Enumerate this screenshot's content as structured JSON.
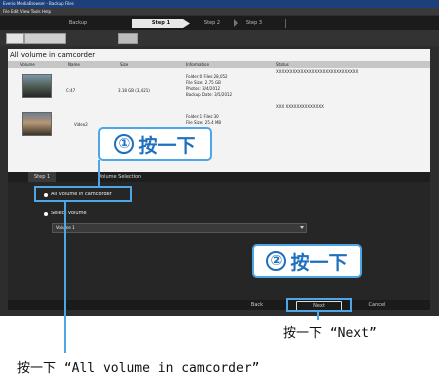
{
  "window": {
    "title": "Everio MediaBrowser - Backup Files",
    "menu": "File  Edit  View  Tools  Help"
  },
  "steps": [
    {
      "label": "Backup"
    },
    {
      "label": "Step 1"
    },
    {
      "label": "Step 2"
    },
    {
      "label": "Step 3"
    }
  ],
  "content": {
    "title": "All volume in camcorder",
    "columns": [
      "Volume",
      "Name",
      "Size",
      "Information",
      "Status"
    ],
    "rows": [
      {
        "name": "C:47",
        "size": "3.18 GB (3,421)",
        "info": [
          "Folder:0 Files:28,052",
          "File Size: 2.75 GB",
          "Photos: 3/4/2012",
          "Backup Date: 3/5/2012"
        ],
        "status": "XXXXXXXXXXXXXXXXXXXXXXXXXXXXXX"
      },
      {
        "name": "Video2",
        "size": "",
        "info": [
          "Folder:1 Files:30",
          "File Size: 25.4 MB"
        ],
        "status": "XXX XXXXXXXXXXXXXX"
      }
    ]
  },
  "lower": {
    "tabs": [
      "Step 1",
      "Volume Selection"
    ],
    "option_all": "All volume in camcorder",
    "option_select": "Select volume",
    "select_value": "Volume 1"
  },
  "footer": {
    "back": "Back",
    "next": "Next",
    "cancel": "Cancel"
  },
  "callouts": {
    "one_num": "①",
    "one_text": "按一下",
    "two_num": "②",
    "two_text": "按一下"
  },
  "captions": {
    "next": "按一下 “Next”",
    "all": "按一下 “All volume in camcorder”"
  },
  "colors": {
    "accent": "#4ca6e8",
    "callout_text": "#1e6fc0"
  }
}
